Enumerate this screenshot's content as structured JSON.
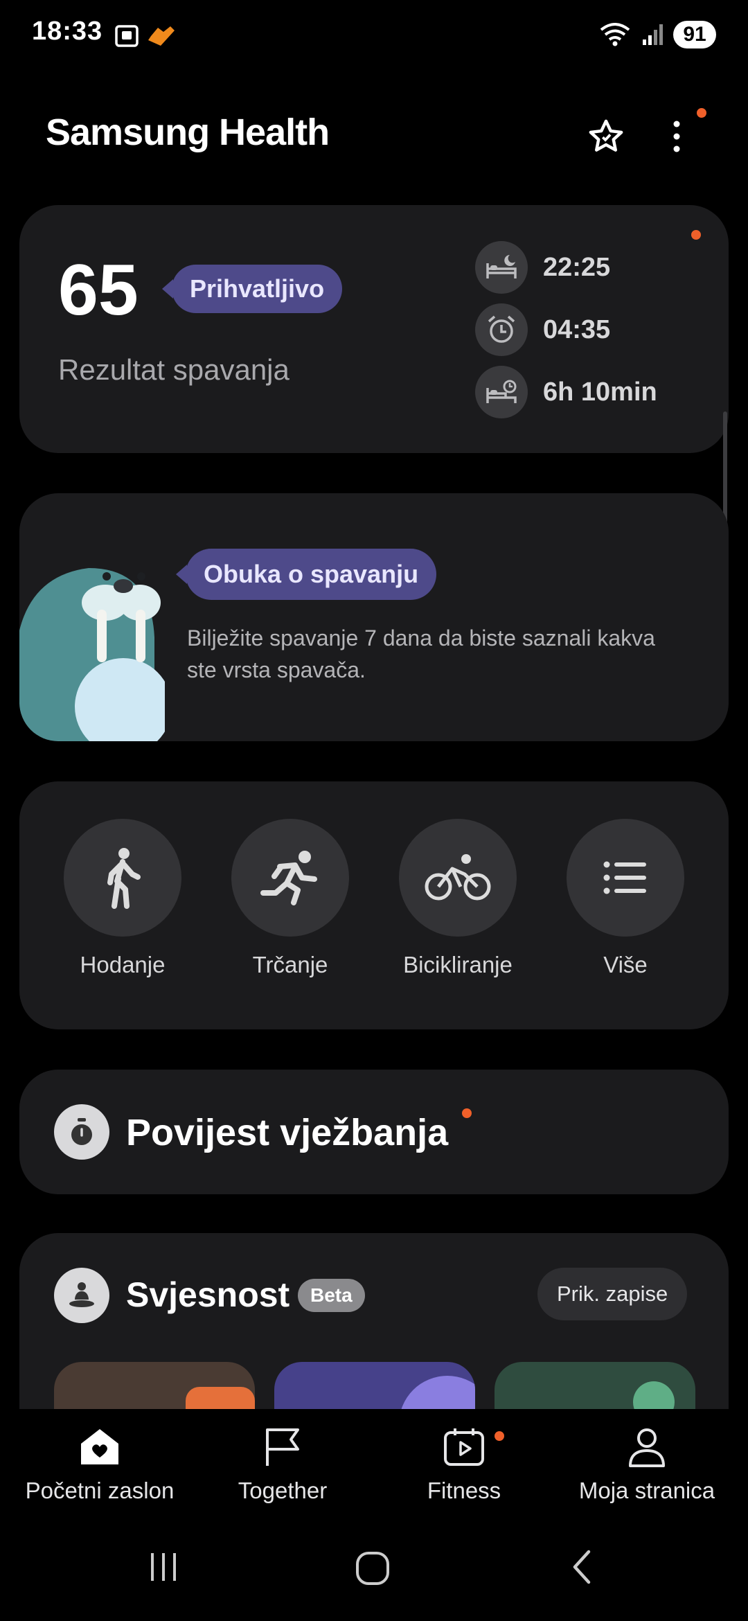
{
  "status_bar": {
    "time": "18:33",
    "battery": "91",
    "icons": [
      "screenshot-icon",
      "health-app-icon",
      "wifi-icon",
      "signal-icon"
    ]
  },
  "header": {
    "title": "Samsung Health",
    "icons": [
      "star-icon",
      "more-options-icon"
    ]
  },
  "sleep_card": {
    "score": "65",
    "rating": "Prihvatljivo",
    "label": "Rezultat spavanja",
    "bedtime": "22:25",
    "wake_time": "04:35",
    "duration": "6h 10min"
  },
  "coaching_card": {
    "title": "Obuka o spavanju",
    "description": "Bilježite spavanje 7 dana da biste saznali kakva ste vrsta spavača."
  },
  "activities": [
    {
      "label": "Hodanje",
      "icon": "walking-icon"
    },
    {
      "label": "Trčanje",
      "icon": "running-icon"
    },
    {
      "label": "Bicikliranje",
      "icon": "cycling-icon"
    },
    {
      "label": "Više",
      "icon": "list-icon"
    }
  ],
  "exercise_history": {
    "title": "Povijest vježbanja"
  },
  "mindfulness": {
    "title": "Svjesnost",
    "badge": "Beta",
    "button": "Prik. zapise"
  },
  "bottom_nav": [
    {
      "label": "Početni zaslon",
      "icon": "home-heart-icon"
    },
    {
      "label": "Together",
      "icon": "flag-icon"
    },
    {
      "label": "Fitness",
      "icon": "calendar-play-icon"
    },
    {
      "label": "Moja stranica",
      "icon": "person-icon"
    }
  ],
  "colors": {
    "background": "#000000",
    "card": "#1b1b1d",
    "accent_pill": "#4e4a8a",
    "notification_dot": "#f0602a"
  }
}
